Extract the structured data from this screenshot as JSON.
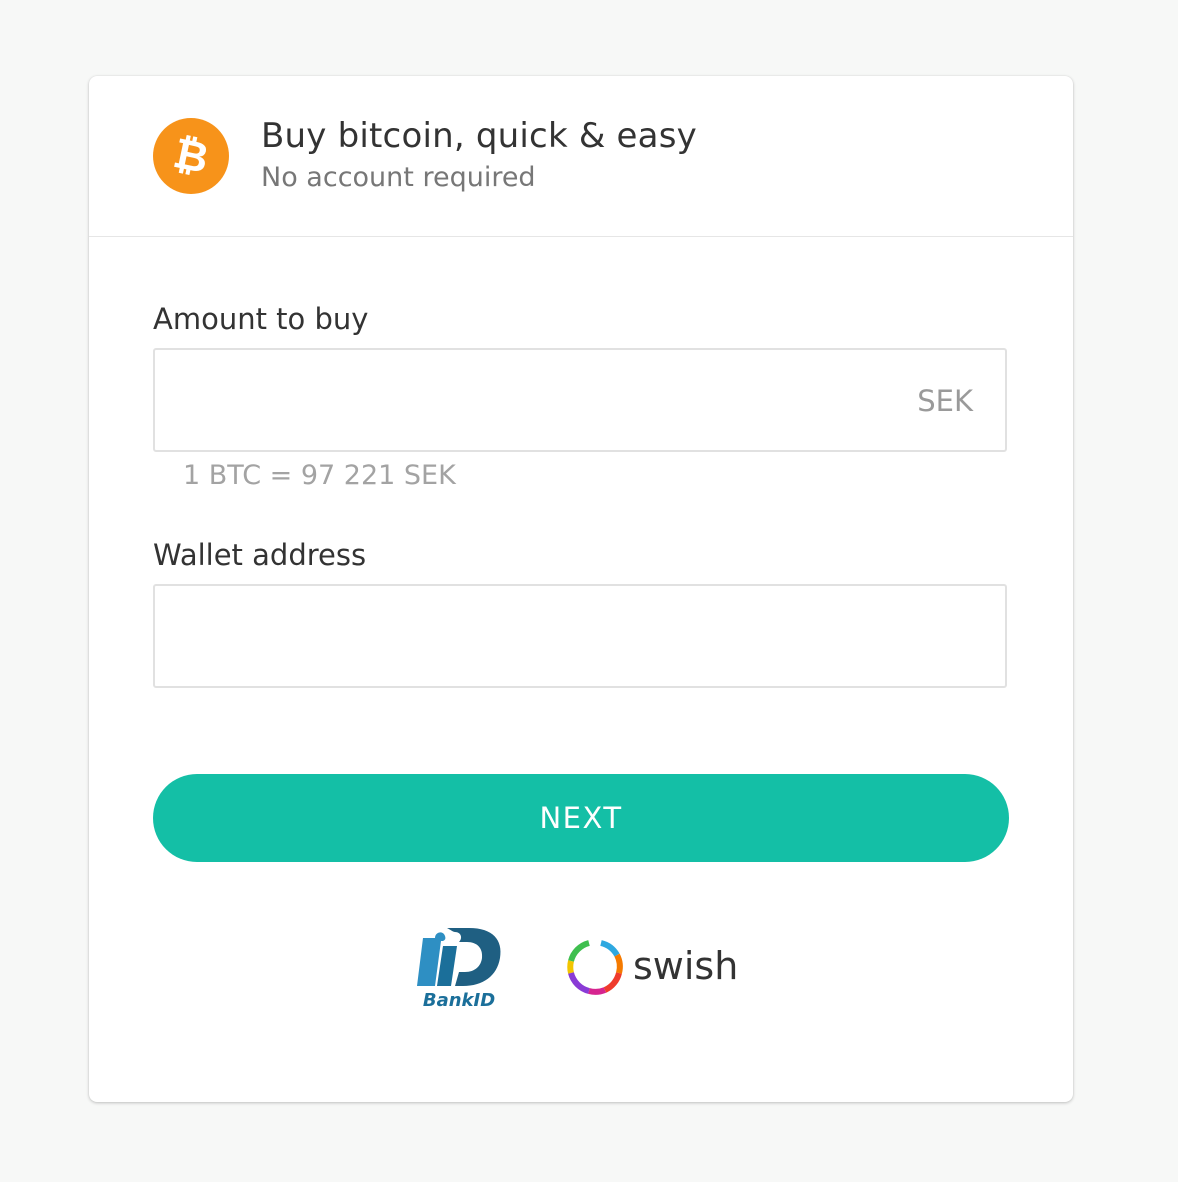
{
  "header": {
    "title": "Buy bitcoin, quick & easy",
    "subtitle": "No account required",
    "logo_symbol": "₿",
    "logo_color": "#f7931a"
  },
  "amount": {
    "label": "Amount to buy",
    "value": "",
    "currency": "SEK",
    "rate": "1 BTC = 97 221 SEK"
  },
  "wallet": {
    "label": "Wallet address",
    "value": ""
  },
  "next_button": {
    "label": "NEXT",
    "color": "#14bfa6"
  },
  "payment_methods": {
    "bankid": "BankID",
    "swish": "swish"
  }
}
